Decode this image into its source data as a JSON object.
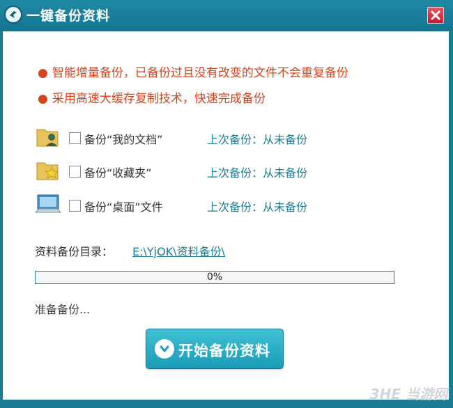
{
  "window": {
    "title": "一键备份资料"
  },
  "features": [
    {
      "bullet": "●",
      "text": "智能增量备份，已备份过且没有改变的文件不会重复备份"
    },
    {
      "bullet": "●",
      "text": "采用高速大缓存复制技术，快速完成备份"
    }
  ],
  "options": [
    {
      "icon": "user-folder-icon",
      "label": "备份“我的文档”",
      "last_label": "上次备份：",
      "last_value": "从未备份",
      "checked": false
    },
    {
      "icon": "favorites-folder-icon",
      "label": "备份“收藏夹”",
      "last_label": "上次备份：",
      "last_value": "从未备份",
      "checked": false
    },
    {
      "icon": "desktop-icon",
      "label": "备份“桌面”文件",
      "last_label": "上次备份：",
      "last_value": "从未备份",
      "checked": false
    }
  ],
  "backup_dir": {
    "label": "资料备份目录：",
    "path": "E:\\YjOK\\资料备份\\"
  },
  "progress": {
    "percent_label": "0%",
    "value": 0
  },
  "status": "准备备份...",
  "start_button": {
    "label": "开始备份资料",
    "icon": "chevron-down-circle-icon"
  },
  "watermark": "3HE 当游网",
  "colors": {
    "titlebar": "#1a7d95",
    "accent": "#1a7f95",
    "feature_text": "#d8421c",
    "close": "#c51a2c"
  }
}
